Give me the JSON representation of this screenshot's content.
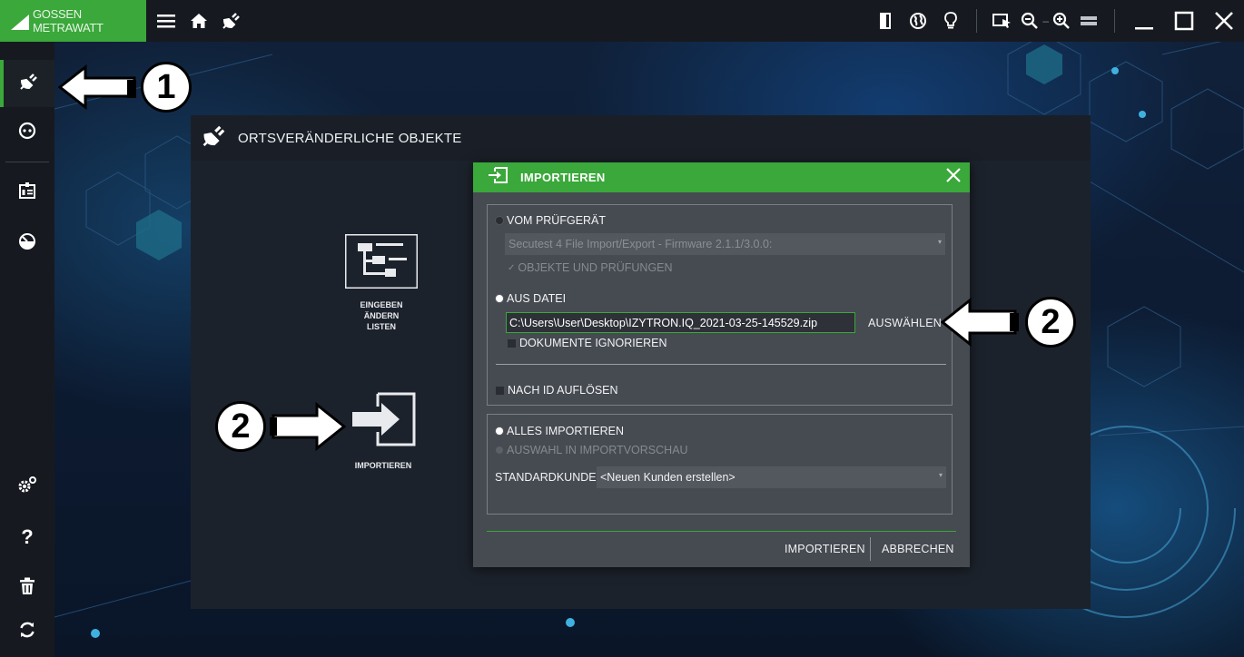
{
  "app": {
    "brand": "GOSSEN METRAWATT"
  },
  "topbar": {
    "icons": [
      "menu-icon",
      "home-icon",
      "plug-icon",
      "door-icon",
      "globe-icon",
      "lightbulb-icon",
      "select-cursor-icon",
      "zoom-out-icon",
      "zoom-in-icon",
      "screen-icon",
      "minimize-icon",
      "maximize-icon",
      "close-icon"
    ]
  },
  "sidebar": {
    "items": [
      "plug-icon",
      "socket-icon",
      "badge-icon",
      "gauge-icon",
      "settings-icon",
      "help-icon",
      "trash-icon",
      "sync-icon"
    ],
    "active": "plug-icon"
  },
  "main": {
    "title": "ORTSVERÄNDERLICHE OBJEKTE",
    "tiles": {
      "edit": {
        "line1": "EINGEBEN",
        "line2": "ÄNDERN",
        "line3": "LISTEN"
      },
      "import": {
        "label": "IMPORTIEREN"
      }
    }
  },
  "dialog": {
    "title": "IMPORTIEREN",
    "from_device": {
      "label": "VOM PRÜFGERÄT",
      "selected": false,
      "device_select": "Secutest 4 File Import/Export - Firmware 2.1.1/3.0.0:",
      "objects_and_tests": "OBJEKTE UND PRÜFUNGEN"
    },
    "from_file": {
      "label": "AUS DATEI",
      "selected": true,
      "path": "C:\\Users\\User\\Desktop\\IZYTRON.IQ_2021-03-25-145529.zip",
      "choose_button": "AUSWÄHLEN",
      "ignore_documents": "DOKUMENTE IGNORIEREN"
    },
    "resolve_by_id": "NACH ID AUFLÖSEN",
    "import_all": "ALLES IMPORTIEREN",
    "selection_in_preview": "AUSWAHL IN IMPORTVORSCHAU",
    "default_customer": {
      "label": "STANDARDKUNDE",
      "value": "<Neuen Kunden erstellen>"
    },
    "import_button": "IMPORTIEREN",
    "cancel_button": "ABBRECHEN"
  },
  "callouts": {
    "step1": "1",
    "step2_right": "2",
    "step2_left": "2"
  },
  "colors": {
    "accent": "#3aa83a",
    "bar": "#161a20",
    "panel": "#1c222b",
    "dialog": "#464a51"
  }
}
